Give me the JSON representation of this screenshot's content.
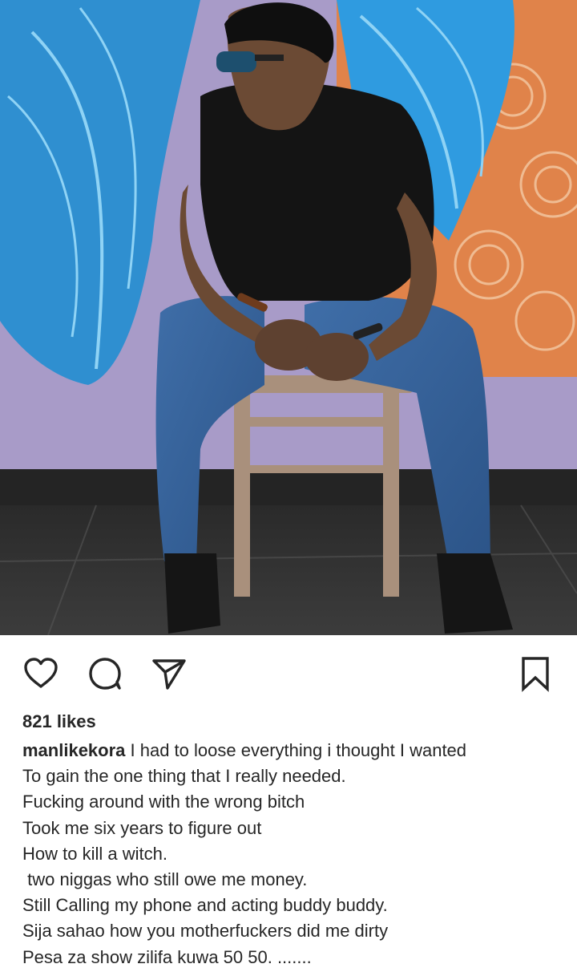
{
  "post": {
    "image_alt": "Man in black polo shirt, bandana and sunglasses sitting on a wooden stool in front of a colorful mural",
    "likes_text": "821 likes",
    "username": "manlikekora",
    "caption_lines": [
      " I had to loose everything i thought I wanted",
      "To gain the one thing that I really needed.",
      "Fucking around with the wrong bitch",
      "Took me six years to figure out",
      "How to kill a witch.",
      " two niggas who still owe me money.",
      "Still Calling my phone and acting buddy buddy.",
      "Sija sahao how you motherfuckers did me dirty",
      "Pesa za show zilifa kuwa 50 50. ......."
    ]
  },
  "actions": {
    "like": "heart-icon",
    "comment": "comment-bubble-icon",
    "share": "paper-plane-icon",
    "save": "bookmark-icon"
  },
  "colors": {
    "text": "#262626",
    "icon": "#262626",
    "background": "#ffffff"
  }
}
